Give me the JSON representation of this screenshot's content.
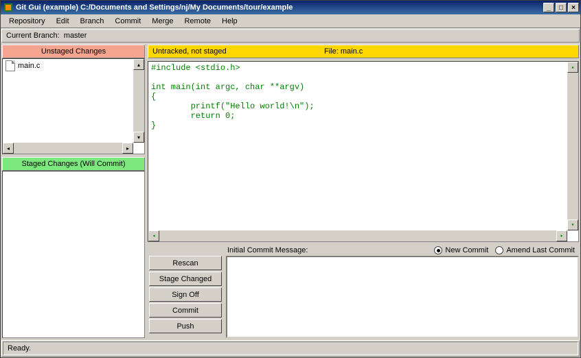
{
  "window": {
    "title": "Git Gui (example) C:/Documents and Settings/nj/My Documents/tour/example"
  },
  "menu": {
    "items": [
      "Repository",
      "Edit",
      "Branch",
      "Commit",
      "Merge",
      "Remote",
      "Help"
    ]
  },
  "branch_label": "Current Branch:",
  "branch_name": "master",
  "left": {
    "unstaged_header": "Unstaged Changes",
    "staged_header": "Staged Changes (Will Commit)",
    "unstaged_files": [
      {
        "name": "main.c"
      }
    ],
    "staged_files": []
  },
  "diff": {
    "status": "Untracked, not staged",
    "file_label": "File:",
    "file_name": "main.c",
    "content": "#include <stdio.h>\n\nint main(int argc, char **argv)\n{\n        printf(\"Hello world!\\n\");\n        return 0;\n}"
  },
  "commit": {
    "label": "Initial Commit Message:",
    "radio_new": "New Commit",
    "radio_amend": "Amend Last Commit",
    "selected": "new",
    "message": ""
  },
  "buttons": {
    "rescan": "Rescan",
    "stage_changed": "Stage Changed",
    "sign_off": "Sign Off",
    "commit": "Commit",
    "push": "Push"
  },
  "status_text": "Ready."
}
